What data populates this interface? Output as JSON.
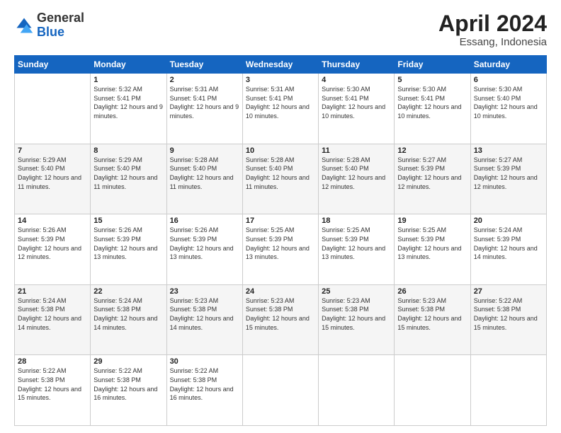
{
  "header": {
    "logo_line1": "General",
    "logo_line2": "Blue",
    "title": "April 2024",
    "subtitle": "Essang, Indonesia"
  },
  "columns": [
    "Sunday",
    "Monday",
    "Tuesday",
    "Wednesday",
    "Thursday",
    "Friday",
    "Saturday"
  ],
  "weeks": [
    [
      {
        "day": "",
        "sunrise": "",
        "sunset": "",
        "daylight": ""
      },
      {
        "day": "1",
        "sunrise": "Sunrise: 5:32 AM",
        "sunset": "Sunset: 5:41 PM",
        "daylight": "Daylight: 12 hours and 9 minutes."
      },
      {
        "day": "2",
        "sunrise": "Sunrise: 5:31 AM",
        "sunset": "Sunset: 5:41 PM",
        "daylight": "Daylight: 12 hours and 9 minutes."
      },
      {
        "day": "3",
        "sunrise": "Sunrise: 5:31 AM",
        "sunset": "Sunset: 5:41 PM",
        "daylight": "Daylight: 12 hours and 10 minutes."
      },
      {
        "day": "4",
        "sunrise": "Sunrise: 5:30 AM",
        "sunset": "Sunset: 5:41 PM",
        "daylight": "Daylight: 12 hours and 10 minutes."
      },
      {
        "day": "5",
        "sunrise": "Sunrise: 5:30 AM",
        "sunset": "Sunset: 5:41 PM",
        "daylight": "Daylight: 12 hours and 10 minutes."
      },
      {
        "day": "6",
        "sunrise": "Sunrise: 5:30 AM",
        "sunset": "Sunset: 5:40 PM",
        "daylight": "Daylight: 12 hours and 10 minutes."
      }
    ],
    [
      {
        "day": "7",
        "sunrise": "Sunrise: 5:29 AM",
        "sunset": "Sunset: 5:40 PM",
        "daylight": "Daylight: 12 hours and 11 minutes."
      },
      {
        "day": "8",
        "sunrise": "Sunrise: 5:29 AM",
        "sunset": "Sunset: 5:40 PM",
        "daylight": "Daylight: 12 hours and 11 minutes."
      },
      {
        "day": "9",
        "sunrise": "Sunrise: 5:28 AM",
        "sunset": "Sunset: 5:40 PM",
        "daylight": "Daylight: 12 hours and 11 minutes."
      },
      {
        "day": "10",
        "sunrise": "Sunrise: 5:28 AM",
        "sunset": "Sunset: 5:40 PM",
        "daylight": "Daylight: 12 hours and 11 minutes."
      },
      {
        "day": "11",
        "sunrise": "Sunrise: 5:28 AM",
        "sunset": "Sunset: 5:40 PM",
        "daylight": "Daylight: 12 hours and 12 minutes."
      },
      {
        "day": "12",
        "sunrise": "Sunrise: 5:27 AM",
        "sunset": "Sunset: 5:39 PM",
        "daylight": "Daylight: 12 hours and 12 minutes."
      },
      {
        "day": "13",
        "sunrise": "Sunrise: 5:27 AM",
        "sunset": "Sunset: 5:39 PM",
        "daylight": "Daylight: 12 hours and 12 minutes."
      }
    ],
    [
      {
        "day": "14",
        "sunrise": "Sunrise: 5:26 AM",
        "sunset": "Sunset: 5:39 PM",
        "daylight": "Daylight: 12 hours and 12 minutes."
      },
      {
        "day": "15",
        "sunrise": "Sunrise: 5:26 AM",
        "sunset": "Sunset: 5:39 PM",
        "daylight": "Daylight: 12 hours and 13 minutes."
      },
      {
        "day": "16",
        "sunrise": "Sunrise: 5:26 AM",
        "sunset": "Sunset: 5:39 PM",
        "daylight": "Daylight: 12 hours and 13 minutes."
      },
      {
        "day": "17",
        "sunrise": "Sunrise: 5:25 AM",
        "sunset": "Sunset: 5:39 PM",
        "daylight": "Daylight: 12 hours and 13 minutes."
      },
      {
        "day": "18",
        "sunrise": "Sunrise: 5:25 AM",
        "sunset": "Sunset: 5:39 PM",
        "daylight": "Daylight: 12 hours and 13 minutes."
      },
      {
        "day": "19",
        "sunrise": "Sunrise: 5:25 AM",
        "sunset": "Sunset: 5:39 PM",
        "daylight": "Daylight: 12 hours and 13 minutes."
      },
      {
        "day": "20",
        "sunrise": "Sunrise: 5:24 AM",
        "sunset": "Sunset: 5:39 PM",
        "daylight": "Daylight: 12 hours and 14 minutes."
      }
    ],
    [
      {
        "day": "21",
        "sunrise": "Sunrise: 5:24 AM",
        "sunset": "Sunset: 5:38 PM",
        "daylight": "Daylight: 12 hours and 14 minutes."
      },
      {
        "day": "22",
        "sunrise": "Sunrise: 5:24 AM",
        "sunset": "Sunset: 5:38 PM",
        "daylight": "Daylight: 12 hours and 14 minutes."
      },
      {
        "day": "23",
        "sunrise": "Sunrise: 5:23 AM",
        "sunset": "Sunset: 5:38 PM",
        "daylight": "Daylight: 12 hours and 14 minutes."
      },
      {
        "day": "24",
        "sunrise": "Sunrise: 5:23 AM",
        "sunset": "Sunset: 5:38 PM",
        "daylight": "Daylight: 12 hours and 15 minutes."
      },
      {
        "day": "25",
        "sunrise": "Sunrise: 5:23 AM",
        "sunset": "Sunset: 5:38 PM",
        "daylight": "Daylight: 12 hours and 15 minutes."
      },
      {
        "day": "26",
        "sunrise": "Sunrise: 5:23 AM",
        "sunset": "Sunset: 5:38 PM",
        "daylight": "Daylight: 12 hours and 15 minutes."
      },
      {
        "day": "27",
        "sunrise": "Sunrise: 5:22 AM",
        "sunset": "Sunset: 5:38 PM",
        "daylight": "Daylight: 12 hours and 15 minutes."
      }
    ],
    [
      {
        "day": "28",
        "sunrise": "Sunrise: 5:22 AM",
        "sunset": "Sunset: 5:38 PM",
        "daylight": "Daylight: 12 hours and 15 minutes."
      },
      {
        "day": "29",
        "sunrise": "Sunrise: 5:22 AM",
        "sunset": "Sunset: 5:38 PM",
        "daylight": "Daylight: 12 hours and 16 minutes."
      },
      {
        "day": "30",
        "sunrise": "Sunrise: 5:22 AM",
        "sunset": "Sunset: 5:38 PM",
        "daylight": "Daylight: 12 hours and 16 minutes."
      },
      {
        "day": "",
        "sunrise": "",
        "sunset": "",
        "daylight": ""
      },
      {
        "day": "",
        "sunrise": "",
        "sunset": "",
        "daylight": ""
      },
      {
        "day": "",
        "sunrise": "",
        "sunset": "",
        "daylight": ""
      },
      {
        "day": "",
        "sunrise": "",
        "sunset": "",
        "daylight": ""
      }
    ]
  ]
}
